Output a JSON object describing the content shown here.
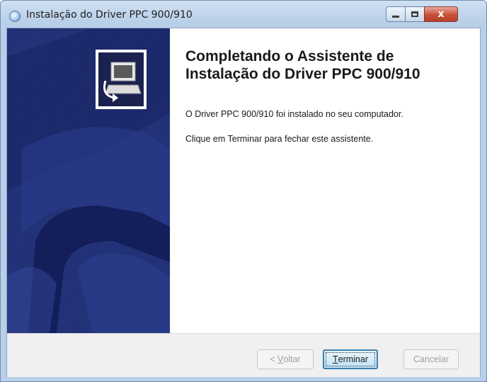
{
  "window": {
    "title": "Instalação do Driver PPC 900/910",
    "controls": {
      "minimize_icon": "minimize-icon",
      "maximize_icon": "maximize-icon",
      "close_icon": "close-icon",
      "close_glyph": "x"
    }
  },
  "wizard": {
    "heading": "Completando o Assistente de Instalação do Driver PPC 900/910",
    "message_installed": "O Driver PPC 900/910 foi instalado no seu computador.",
    "message_finish": "Clique em Terminar para fechar este assistente."
  },
  "buttons": {
    "back_prefix": "< ",
    "back_mnemonic": "V",
    "back_rest": "oltar",
    "finish_mnemonic": "T",
    "finish_rest": "erminar",
    "cancel": "Cancelar"
  },
  "colors": {
    "side_panel": "#1f2e73",
    "finish_border": "#3c7fb1",
    "close_button": "#c8503a"
  }
}
